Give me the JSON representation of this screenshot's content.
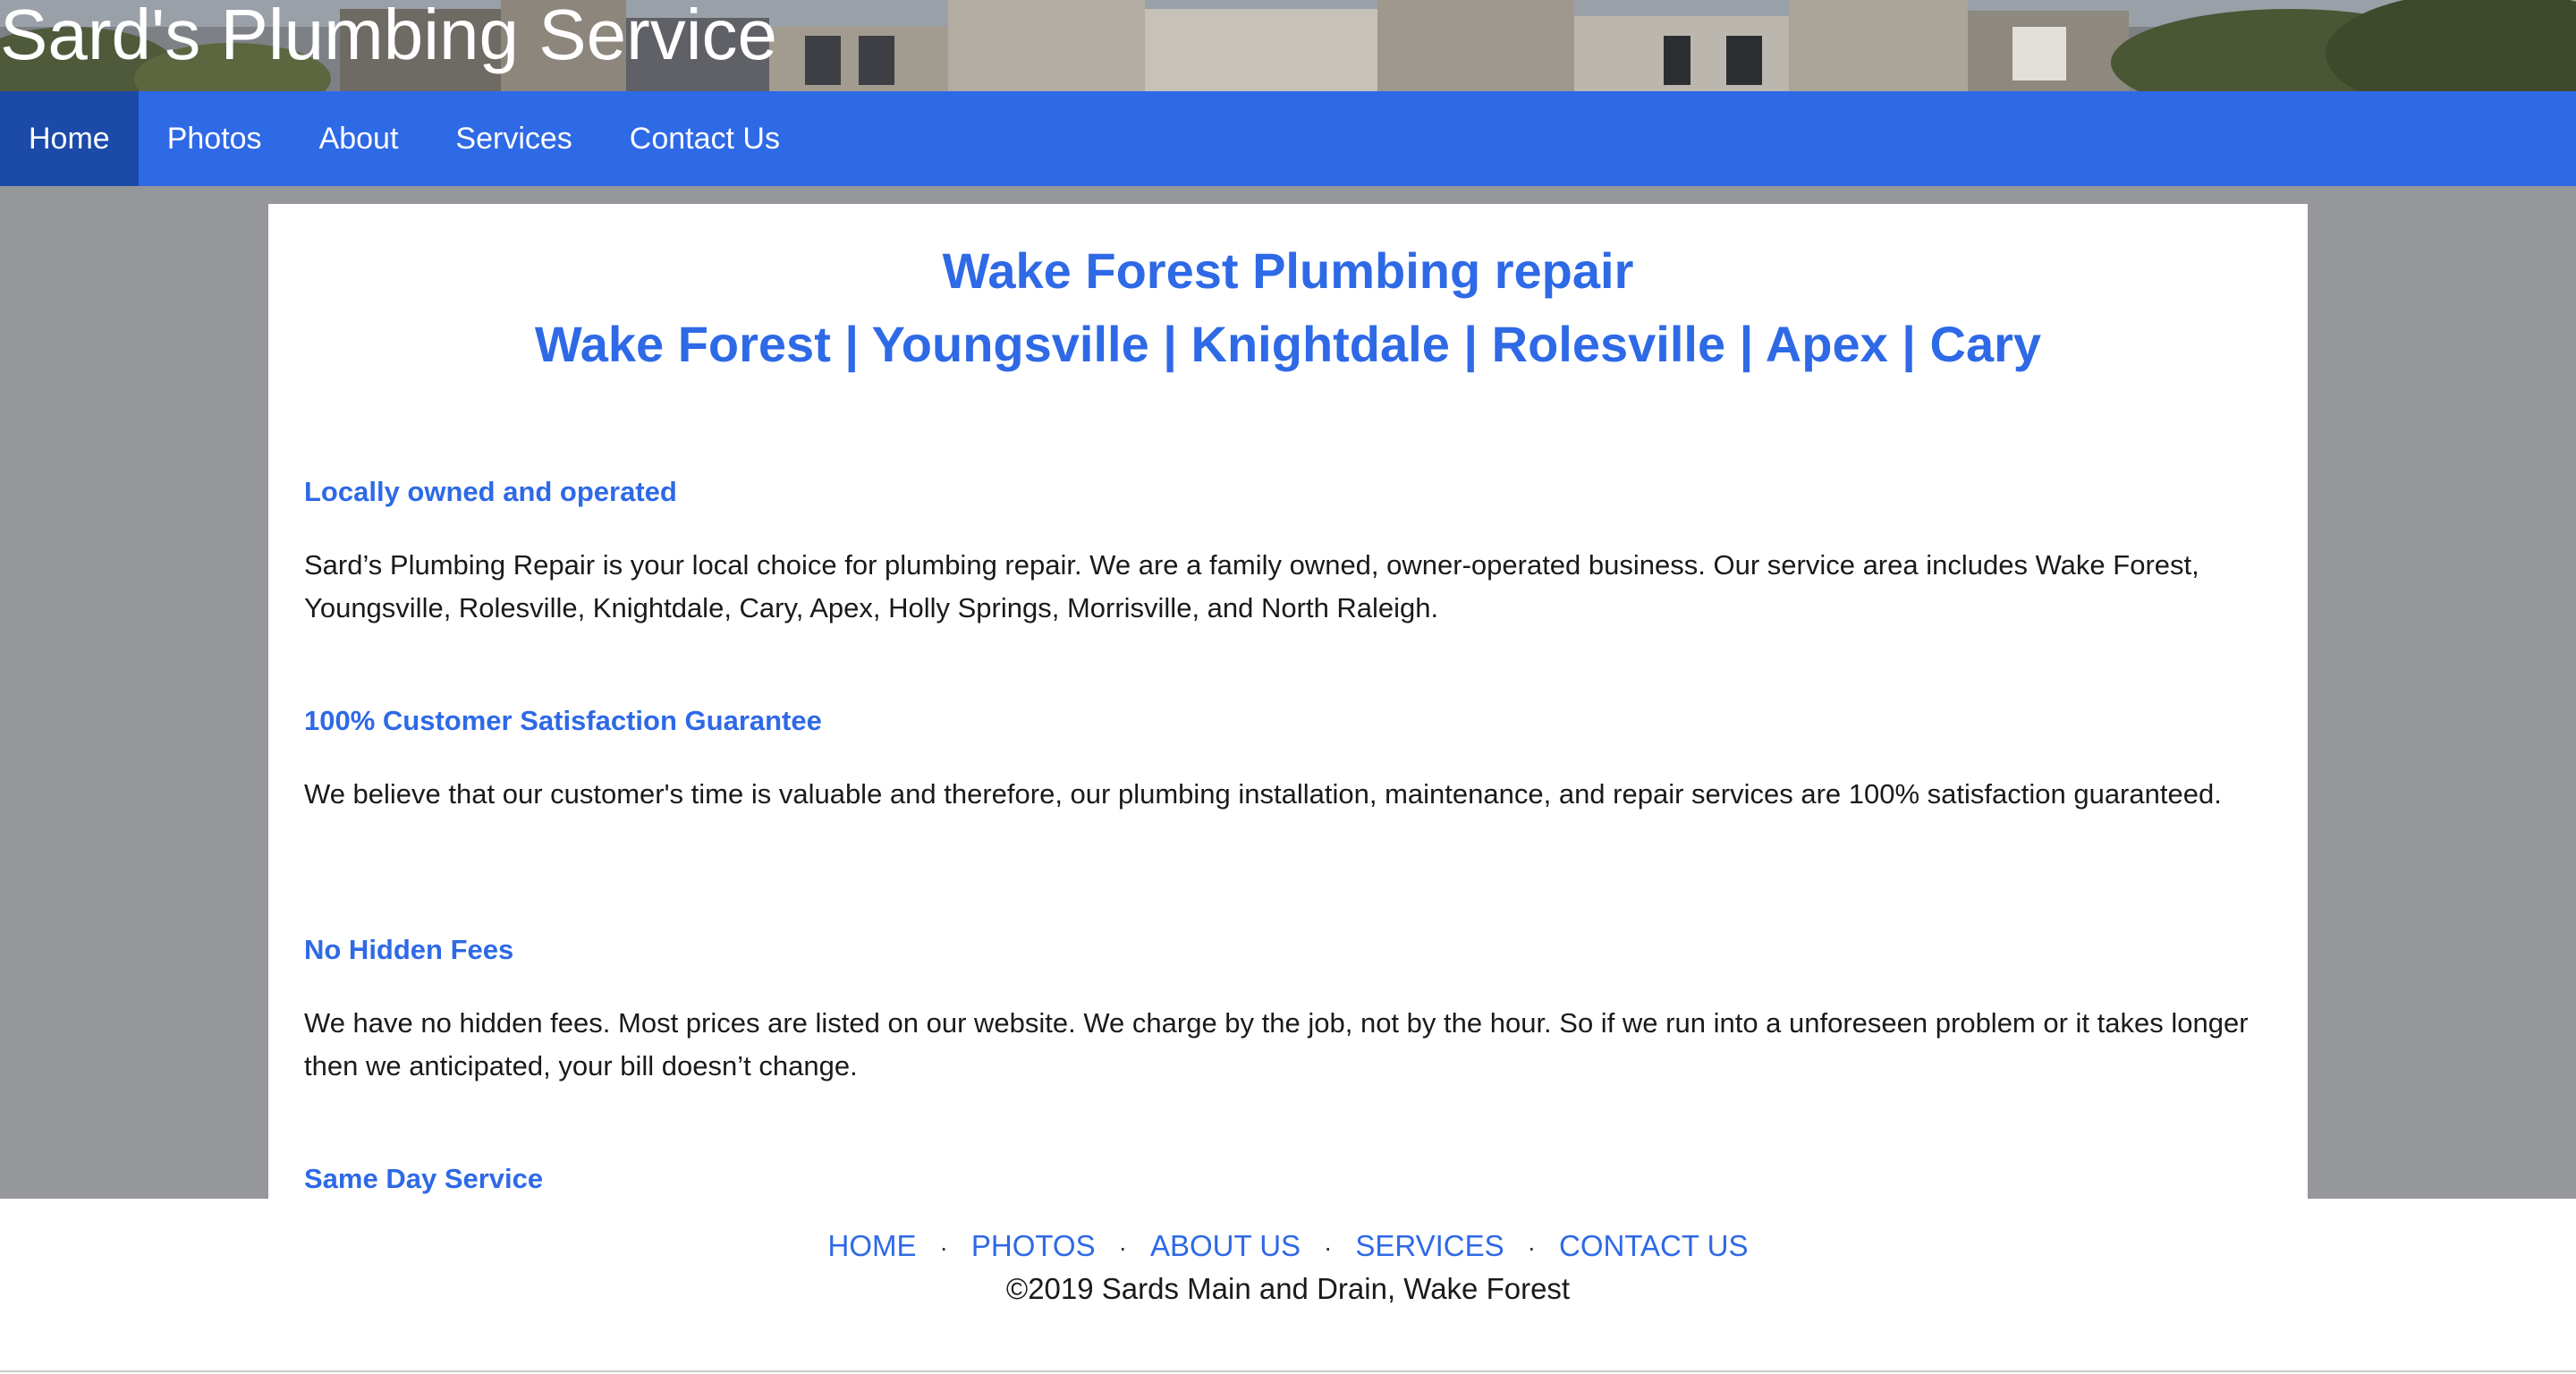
{
  "header": {
    "site_title": "Sard's Plumbing Service"
  },
  "nav": {
    "items": [
      {
        "label": "Home",
        "active": true
      },
      {
        "label": "Photos"
      },
      {
        "label": "About"
      },
      {
        "label": "Services"
      },
      {
        "label": "Contact Us"
      }
    ]
  },
  "main": {
    "heading": "Wake Forest Plumbing repair",
    "subheading": "Wake Forest | Youngsville | Knightdale | Rolesville | Apex | Cary",
    "sections": [
      {
        "title": "Locally owned and operated",
        "text": "Sard’s Plumbing Repair is your local choice for plumbing repair. We are a family owned, owner-operated business. Our service area includes Wake Forest, Youngsville, Rolesville, Knightdale, Cary, Apex, Holly Springs, Morrisville, and North Raleigh."
      },
      {
        "title": "100% Customer Satisfaction Guarantee",
        "text": "We believe that our customer's time is valuable and therefore, our plumbing installation, maintenance, and repair services are 100% satisfaction guaranteed."
      },
      {
        "title": "No Hidden Fees",
        "text": "We have no hidden fees. Most prices are listed on our website. We charge by the job, not by the hour. So if we run into a unforeseen problem or it takes longer then we anticipated, your bill doesn’t change."
      },
      {
        "title": "Same Day Service",
        "text": ""
      }
    ]
  },
  "footer": {
    "links": [
      "HOME",
      "PHOTOS",
      "ABOUT US",
      "SERVICES",
      "CONTACT US"
    ],
    "separator": "·",
    "copyright": "©2019 Sards Main and Drain, Wake Forest"
  },
  "colors": {
    "accent": "#2e69e6",
    "nav_active": "#1b4aa8",
    "page_bg": "#95979b"
  }
}
